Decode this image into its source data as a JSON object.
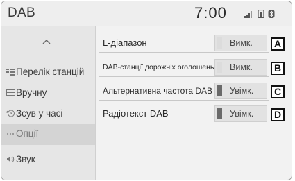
{
  "header": {
    "title": "DAB",
    "time": "7:00"
  },
  "status_icons": [
    "signal-bars-icon",
    "phone-battery-icon",
    "bluetooth-icon"
  ],
  "sidebar": {
    "scroll_up_icon": "chevron-up-icon",
    "items": [
      {
        "label": "Перелік станцій",
        "icon": "station-list-icon",
        "active": false
      },
      {
        "label": "Вручну",
        "icon": "manual-tune-icon",
        "active": false
      },
      {
        "label": "Зсув у часі",
        "icon": "time-shift-icon",
        "active": false
      },
      {
        "label": "Опції",
        "icon": "options-dots-icon",
        "active": true
      },
      {
        "label": "Звук",
        "icon": "speaker-icon",
        "active": false
      }
    ]
  },
  "options": [
    {
      "label": "L-діапазон",
      "toggle": "Вимк.",
      "on": false,
      "callout": "A"
    },
    {
      "label": "DAB-станції дорожніх оголошень",
      "toggle": "Вимк.",
      "on": false,
      "callout": "B"
    },
    {
      "label": "Альтернативна частота DAB",
      "toggle": "Увімк.",
      "on": true,
      "callout": "C"
    },
    {
      "label": "Радіотекст DAB",
      "toggle": "Увімк.",
      "on": true,
      "callout": "D"
    }
  ]
}
